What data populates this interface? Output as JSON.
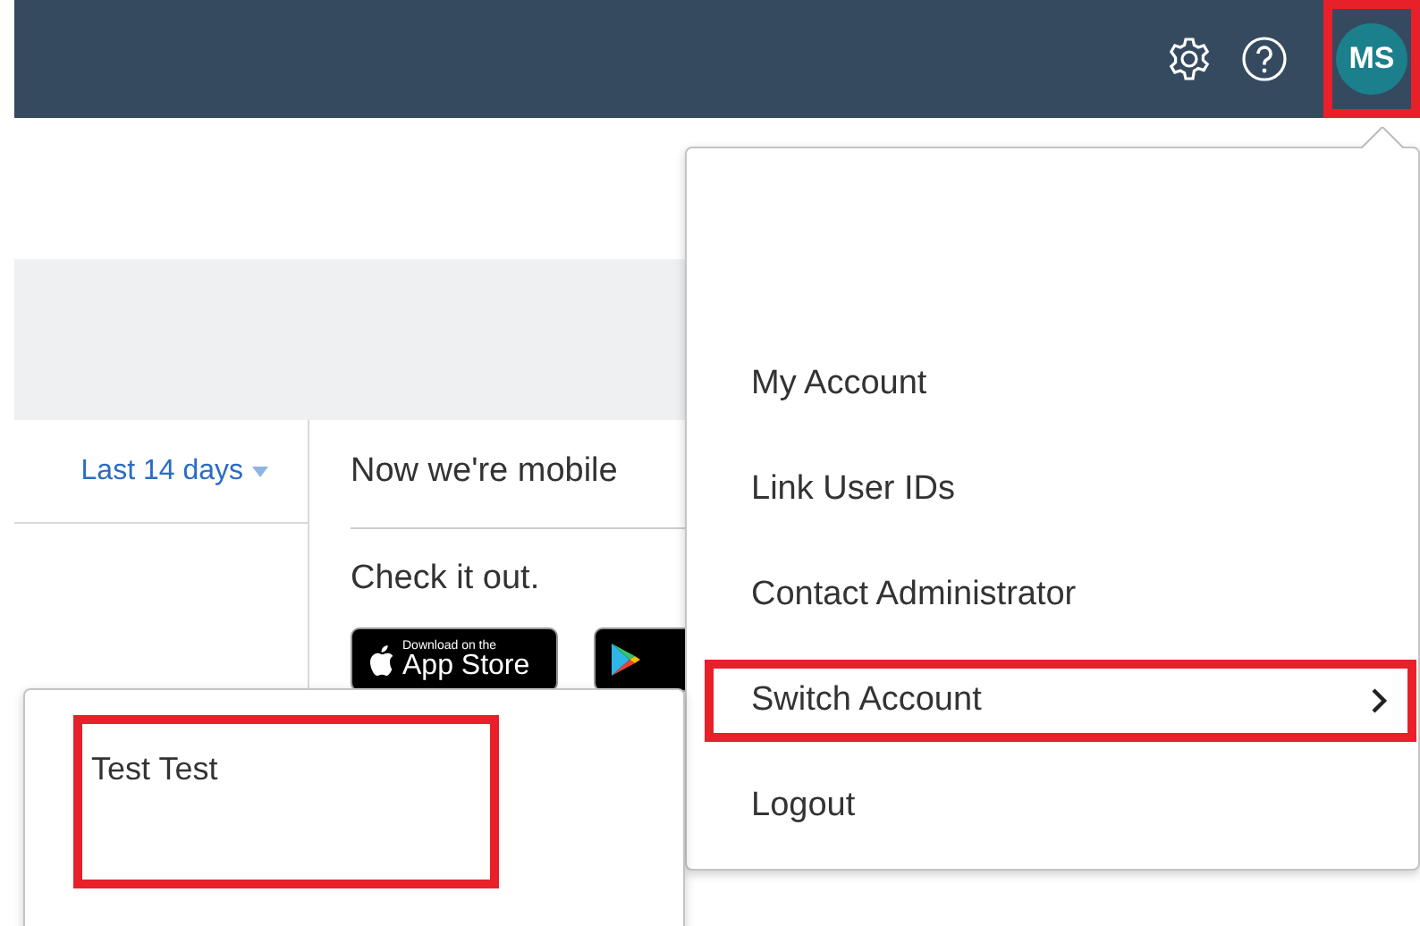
{
  "header": {
    "avatar": {
      "initials": "MS",
      "highlighted": true
    }
  },
  "filter": {
    "range": "Last 14 days"
  },
  "promo": {
    "title": "Now we're mobile",
    "subtitle": "Check it out.",
    "app_store_badge": {
      "caption": "Download on the",
      "store": "App Store"
    }
  },
  "account_menu": {
    "items": [
      {
        "label": "My Account",
        "submenu": false,
        "highlighted": false
      },
      {
        "label": "Link User IDs",
        "submenu": false,
        "highlighted": false
      },
      {
        "label": "Contact Administrator",
        "submenu": false,
        "highlighted": false
      },
      {
        "label": "Switch Account",
        "submenu": true,
        "highlighted": true
      },
      {
        "label": "Logout",
        "submenu": false,
        "highlighted": false
      }
    ]
  },
  "account_list": {
    "items": [
      {
        "label": "Test Test",
        "highlighted": true
      }
    ]
  }
}
